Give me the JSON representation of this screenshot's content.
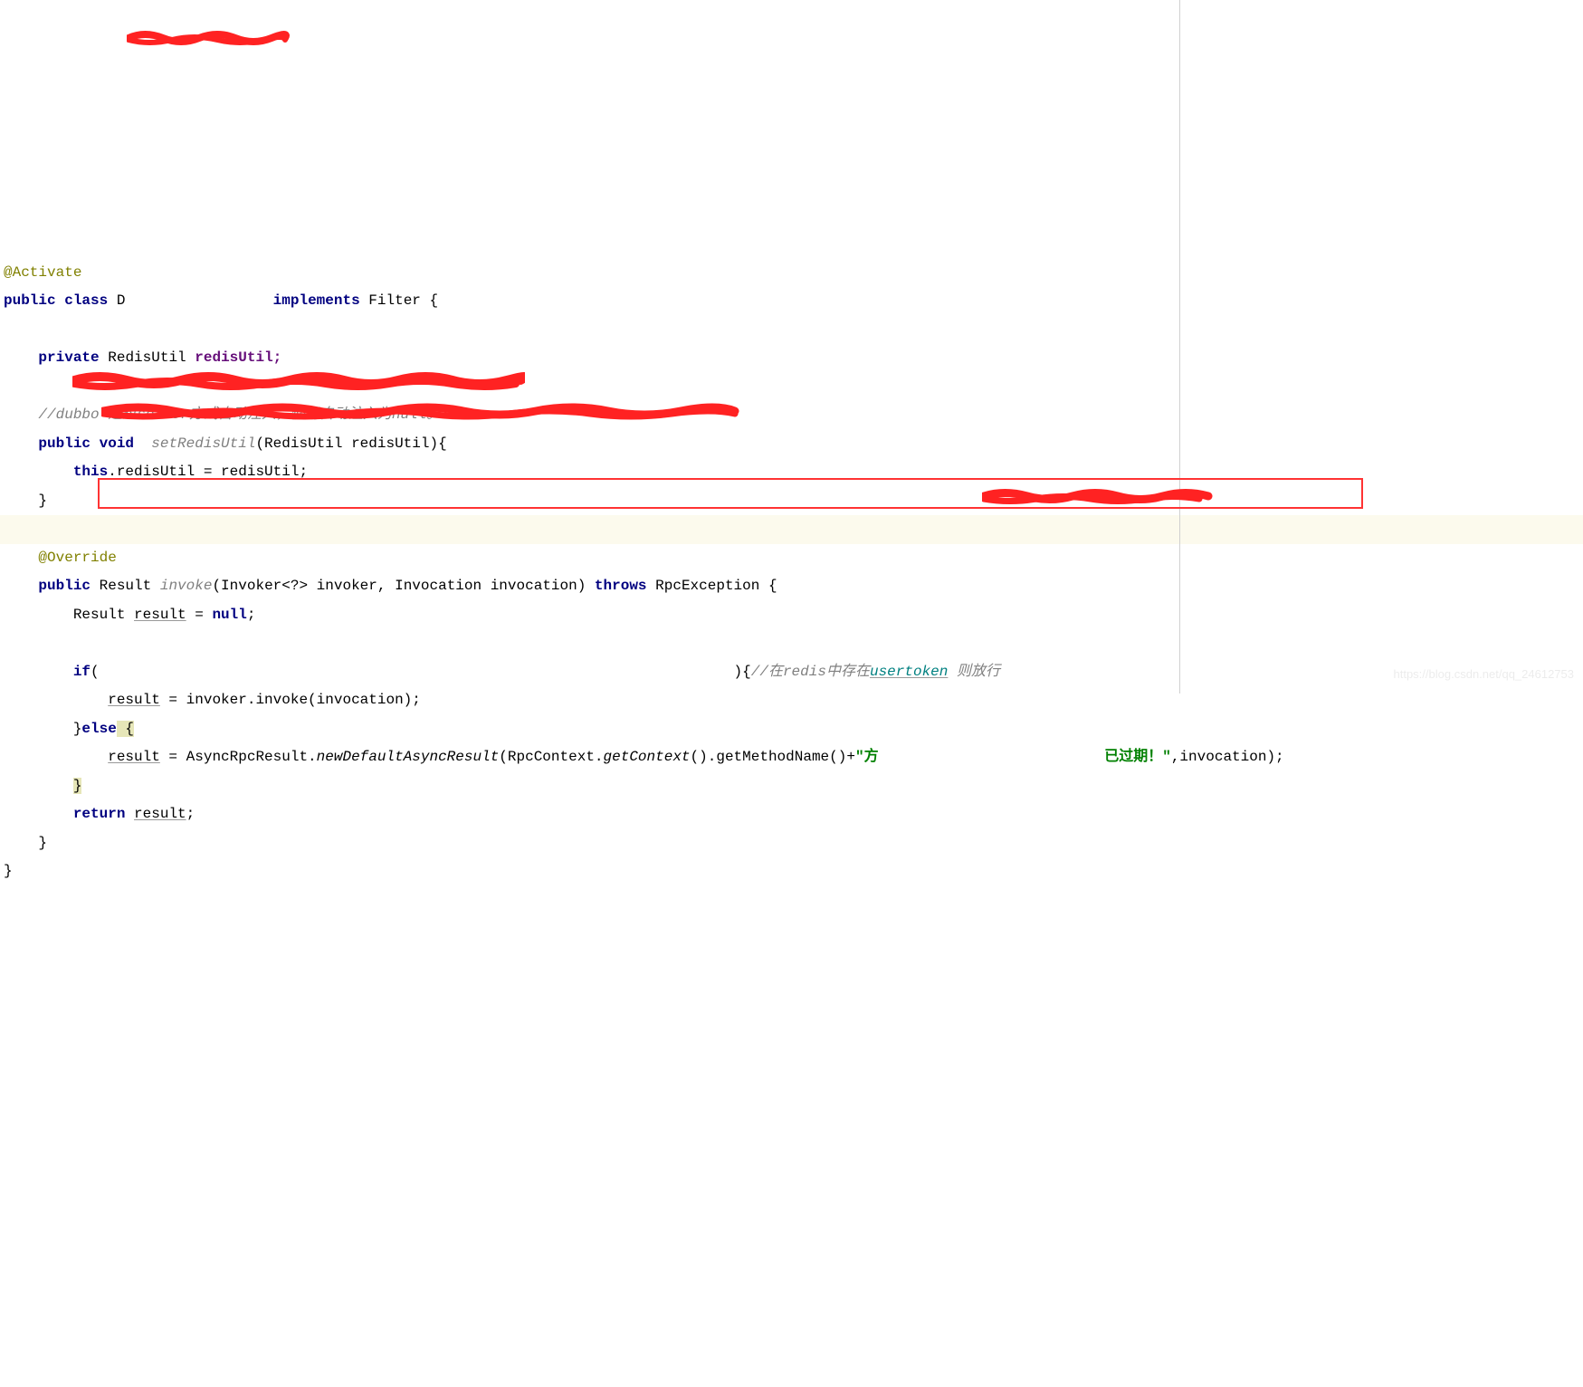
{
  "code": {
    "anno_activate": "@Activate",
    "kw_public": "public",
    "kw_class": "class",
    "class_start": " D",
    "kw_implements": "implements",
    "filter": "Filter",
    "brace_open": " {",
    "kw_private": "private",
    "RedisUtil": "RedisUtil",
    "redisUtil_decl": " redisUtil;",
    "comment_setter": "//dubbo 通过setter方式自动注入，使用自动注入为null。",
    "kw_void": "void",
    "setRedisUtil": "setRedisUtil",
    "param_redis": "(RedisUtil redisUtil){",
    "kw_this": "this",
    "this_assign": ".redisUtil = redisUtil;",
    "close_brace": "}",
    "anno_override": "@Override",
    "Result": "Result",
    "invoke": "invoke",
    "invoke_params": "(Invoker<?> invoker, Invocation invocation) ",
    "kw_throws": "throws",
    "RpcException": " RpcException {",
    "result_var": "result",
    "eq_null": " = ",
    "null_kw": "null",
    "semi": ";",
    "if_kw": "if",
    "if_open": "(",
    "if_close": "){",
    "comment_redis": "//在redis中存在",
    "usertoken": "usertoken",
    "comment_redis2": " 则放行",
    "result_assign_invoke": " = invoker.invoke(invocation);",
    "else_kw": "else",
    "else_open": " {",
    "async_line_1": " = AsyncRpcResult.",
    "newDefaultAsyncResult": "newDefaultAsyncResult",
    "async_line_2": "(RpcContext.",
    "getContext": "getContext",
    "async_line_3": "().getMethodName()+",
    "str_lit_1": "\"方",
    "str_lit_2": "已过期！\"",
    "async_line_4": ",invocation);",
    "return_kw": "return",
    "return_val": " ",
    "close1": "}",
    "close2": "}"
  },
  "watermark": "https://blog.csdn.net/qq_24612753"
}
